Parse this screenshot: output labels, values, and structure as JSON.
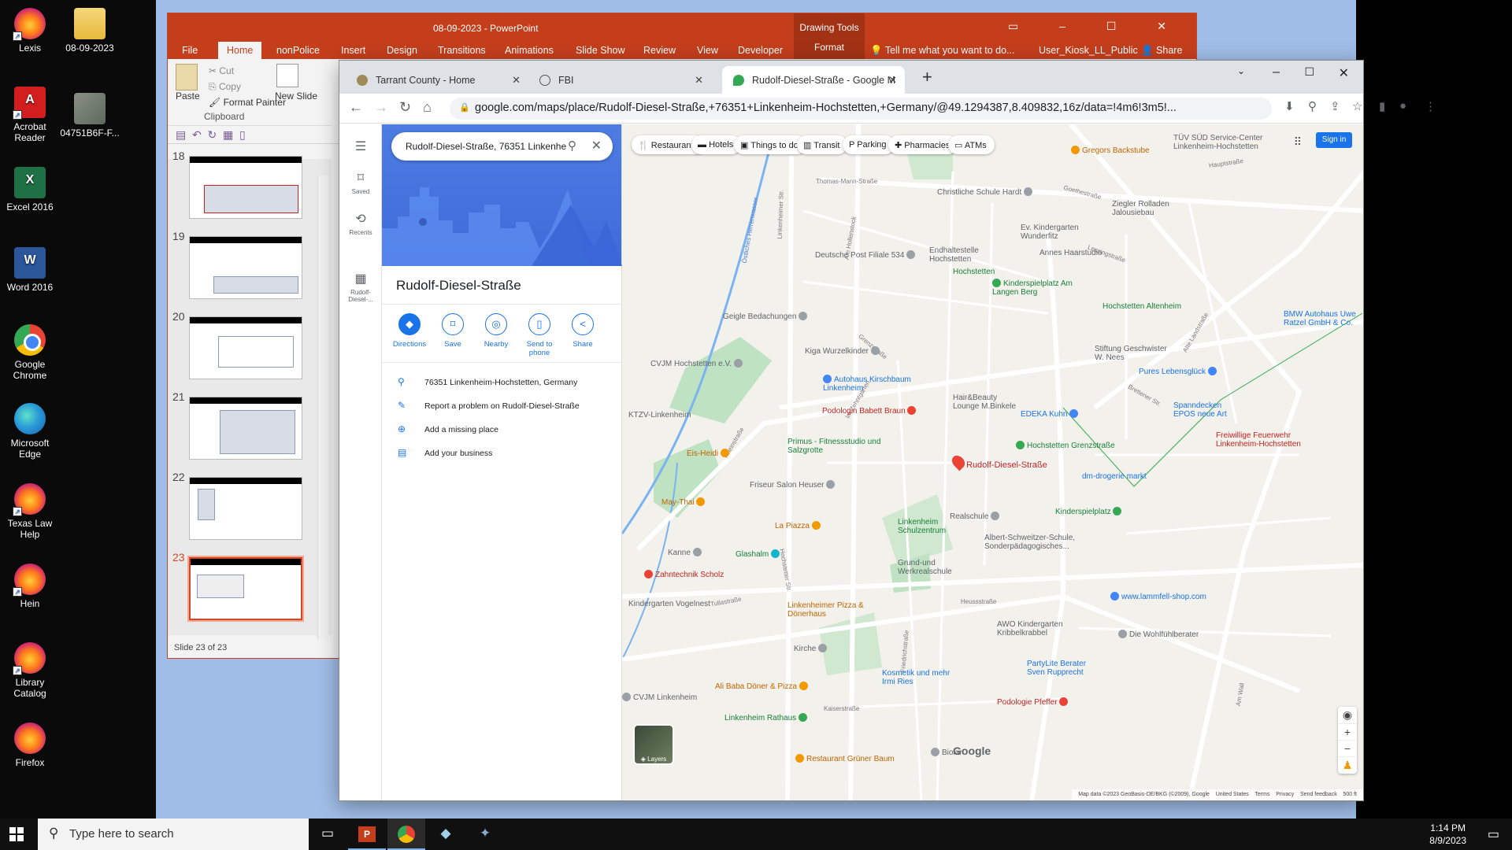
{
  "desktop": {
    "icons": [
      {
        "label": "Lexis",
        "kind": "ff"
      },
      {
        "label": "Acrobat Reader",
        "kind": "acro"
      },
      {
        "label": "Excel 2016",
        "kind": "excel"
      },
      {
        "label": "Word 2016",
        "kind": "word"
      },
      {
        "label": "Google Chrome",
        "kind": "chrome"
      },
      {
        "label": "Microsoft Edge",
        "kind": "edge"
      },
      {
        "label": "Texas Law Help",
        "kind": "ff"
      },
      {
        "label": "Hein",
        "kind": "ff"
      },
      {
        "label": "Library Catalog",
        "kind": "ff"
      },
      {
        "label": "Firefox",
        "kind": "ff"
      },
      {
        "label": "08-09-2023",
        "kind": "folder"
      },
      {
        "label": "04751B6F-F...",
        "kind": "photo"
      }
    ]
  },
  "powerpoint": {
    "title": "08-09-2023 - PowerPoint",
    "drawing_tools": "Drawing Tools",
    "tabs": [
      "File",
      "Home",
      "nonPolice",
      "Insert",
      "Design",
      "Transitions",
      "Animations",
      "Slide Show",
      "Review",
      "View",
      "Developer",
      "Format"
    ],
    "tell_me": "Tell me what you want to do...",
    "user": "User_Kiosk_LL_Public",
    "share": "Share",
    "clipboard": {
      "paste": "Paste",
      "cut": "Cut",
      "copy": "Copy",
      "format_painter": "Format Painter",
      "group": "Clipboard"
    },
    "new_slide": "New Slide",
    "slide_numbers": [
      "18",
      "19",
      "20",
      "21",
      "22",
      "23"
    ],
    "status": "Slide 23 of 23"
  },
  "chrome": {
    "tabs": [
      {
        "title": "Tarrant County - Home",
        "favicon_color": "#a08a5a"
      },
      {
        "title": "FBI",
        "favicon_color": "#555555"
      },
      {
        "title": "Rudolf-Diesel-Straße - Google M",
        "favicon_color": "#34a853"
      }
    ],
    "url": "google.com/maps/place/Rudolf-Diesel-Straße,+76351+Linkenheim-Hochstetten,+Germany/@49.1294387,8.409832,16z/data=!4m6!3m5!..."
  },
  "maps": {
    "rail": [
      {
        "label": "Saved",
        "icon": "bookmark-icon"
      },
      {
        "label": "Recents",
        "icon": "history-icon"
      },
      {
        "label": "Rudolf-Diesel-...",
        "icon": "place-icon"
      }
    ],
    "search_value": "Rudolf-Diesel-Straße, 76351 Linkenhe",
    "place_title": "Rudolf-Diesel-Straße",
    "actions": [
      "Directions",
      "Save",
      "Nearby",
      "Send to phone",
      "Share"
    ],
    "info": [
      {
        "text": "76351 Linkenheim-Hochstetten, Germany",
        "icon": "pin-icon"
      },
      {
        "text": "Report a problem on Rudolf-Diesel-Straße",
        "icon": "pencil-icon"
      },
      {
        "text": "Add a missing place",
        "icon": "add-place-icon"
      },
      {
        "text": "Add your business",
        "icon": "business-icon"
      }
    ],
    "chips": [
      "Restaurants",
      "Hotels",
      "Things to do",
      "Transit",
      "Parking",
      "Pharmacies",
      "ATMs"
    ],
    "sign_in": "Sign in",
    "layers": "Layers",
    "google_logo": "Google",
    "attribution": [
      "Map data ©2023 GeoBasis-DE/BKG (©2009), Google",
      "United States",
      "Terms",
      "Privacy",
      "Send feedback",
      "500 ft"
    ],
    "labels": [
      {
        "t": "Rudolf-Diesel-Straße",
        "c": "red"
      },
      {
        "t": "Gregors Backstube",
        "c": "org"
      },
      {
        "t": "TÜV SÜD Service-Center Linkenheim-Hochstetten",
        "c": "poi"
      },
      {
        "t": "Christliche Schule Hardt",
        "c": "poi"
      },
      {
        "t": "Ziegler Rolladen Jalousiebau",
        "c": "poi"
      },
      {
        "t": "Deutsche Post Filiale 534",
        "c": "poi"
      },
      {
        "t": "Endhaltestelle Hochstetten",
        "c": "poi"
      },
      {
        "t": "Ev. Kindergarten Wunderfitz",
        "c": "poi"
      },
      {
        "t": "Hochstetten",
        "c": "grn"
      },
      {
        "t": "Annes Haarstudio",
        "c": "poi"
      },
      {
        "t": "Kinderspielplatz Am Langen Berg",
        "c": "grn"
      },
      {
        "t": "Hochstetten Altenheim",
        "c": "grn"
      },
      {
        "t": "BMW Autohaus Uwe Ratzel GmbH & Co.",
        "c": "blu"
      },
      {
        "t": "Geigle Bedachungen",
        "c": "poi"
      },
      {
        "t": "Stiftung Geschwister W. Nees",
        "c": "poi"
      },
      {
        "t": "Kiga Wurzelkinder",
        "c": "poi"
      },
      {
        "t": "Pures Lebensglück",
        "c": "blu"
      },
      {
        "t": "CVJM Hochstetten e.V.",
        "c": "poi"
      },
      {
        "t": "Autohaus Kirschbaum Linkenheim",
        "c": "blu"
      },
      {
        "t": "Hair&Beauty Lounge M.Binkele",
        "c": "poi"
      },
      {
        "t": "Spanndecken EPOS neue Art",
        "c": "blu"
      },
      {
        "t": "KTZV-Linkenheim",
        "c": "poi"
      },
      {
        "t": "Podologin Babett Braun",
        "c": "red"
      },
      {
        "t": "EDEKA Kuhn",
        "c": "blu"
      },
      {
        "t": "Freiwillige Feuerwehr Linkenheim-Hochstetten",
        "c": "red"
      },
      {
        "t": "Eis-Heidi",
        "c": "org"
      },
      {
        "t": "Primus - Fitnessstudio und Salzgrotte",
        "c": "grn"
      },
      {
        "t": "Hochstetten Grenzstraße",
        "c": "grn"
      },
      {
        "t": "dm-drogerie markt",
        "c": "blu"
      },
      {
        "t": "Friseur Salon Heuser",
        "c": "poi"
      },
      {
        "t": "May-Thai",
        "c": "org"
      },
      {
        "t": "Realschule",
        "c": "poi"
      },
      {
        "t": "Kinderspielplatz",
        "c": "grn"
      },
      {
        "t": "La Piazza",
        "c": "org"
      },
      {
        "t": "Linkenheim Schulzentrum",
        "c": "grn"
      },
      {
        "t": "Albert-Schweitzer-Schule, Sonderpädagogisches...",
        "c": "poi"
      },
      {
        "t": "Kanne",
        "c": "poi"
      },
      {
        "t": "Glashalm",
        "c": "grn"
      },
      {
        "t": "Zahntechnik Scholz",
        "c": "red"
      },
      {
        "t": "Grund-und Werkrealschule",
        "c": "poi"
      },
      {
        "t": "www.lammfell-shop.com",
        "c": "blu"
      },
      {
        "t": "Kindergarten Vogelnest",
        "c": "poi"
      },
      {
        "t": "Linkenheimer Pizza & Dönerhaus",
        "c": "org"
      },
      {
        "t": "AWO Kindergarten Kribbelkrabbel",
        "c": "poi"
      },
      {
        "t": "Die Wohlfühlberater",
        "c": "poi"
      },
      {
        "t": "Kirche",
        "c": "poi"
      },
      {
        "t": "PartyLite Berater Sven Rupprecht",
        "c": "blu"
      },
      {
        "t": "Ali Baba Döner & Pizza",
        "c": "org"
      },
      {
        "t": "Kosmetik und mehr Irmi Ries",
        "c": "blu"
      },
      {
        "t": "CVJM Linkenheim",
        "c": "poi"
      },
      {
        "t": "Podologie Pfeffer",
        "c": "red"
      },
      {
        "t": "Linkenheim Rathaus",
        "c": "grn"
      },
      {
        "t": "Restaurant Grüner Baum",
        "c": "org"
      },
      {
        "t": "Biolar",
        "c": "poi"
      }
    ],
    "streets": [
      "Hauptstraße",
      "Thomas-Mann-Straße",
      "Goethestraße",
      "Lessingstraße",
      "Östliches Herrenwasser",
      "Linkenheimer Str.",
      "Am Hollenstock",
      "Grenzstraße",
      "Rheinstraße",
      "Hochstetter Str.",
      "Friedrichstraße",
      "Tullastraße",
      "Heussstraße",
      "Kaiserstraße",
      "Am Wall",
      "Alte Landstraße",
      "Brettener Str.",
      "Im Zehntgarten"
    ]
  },
  "taskbar": {
    "search_placeholder": "Type here to search",
    "time": "1:14 PM",
    "date": "8/9/2023"
  }
}
